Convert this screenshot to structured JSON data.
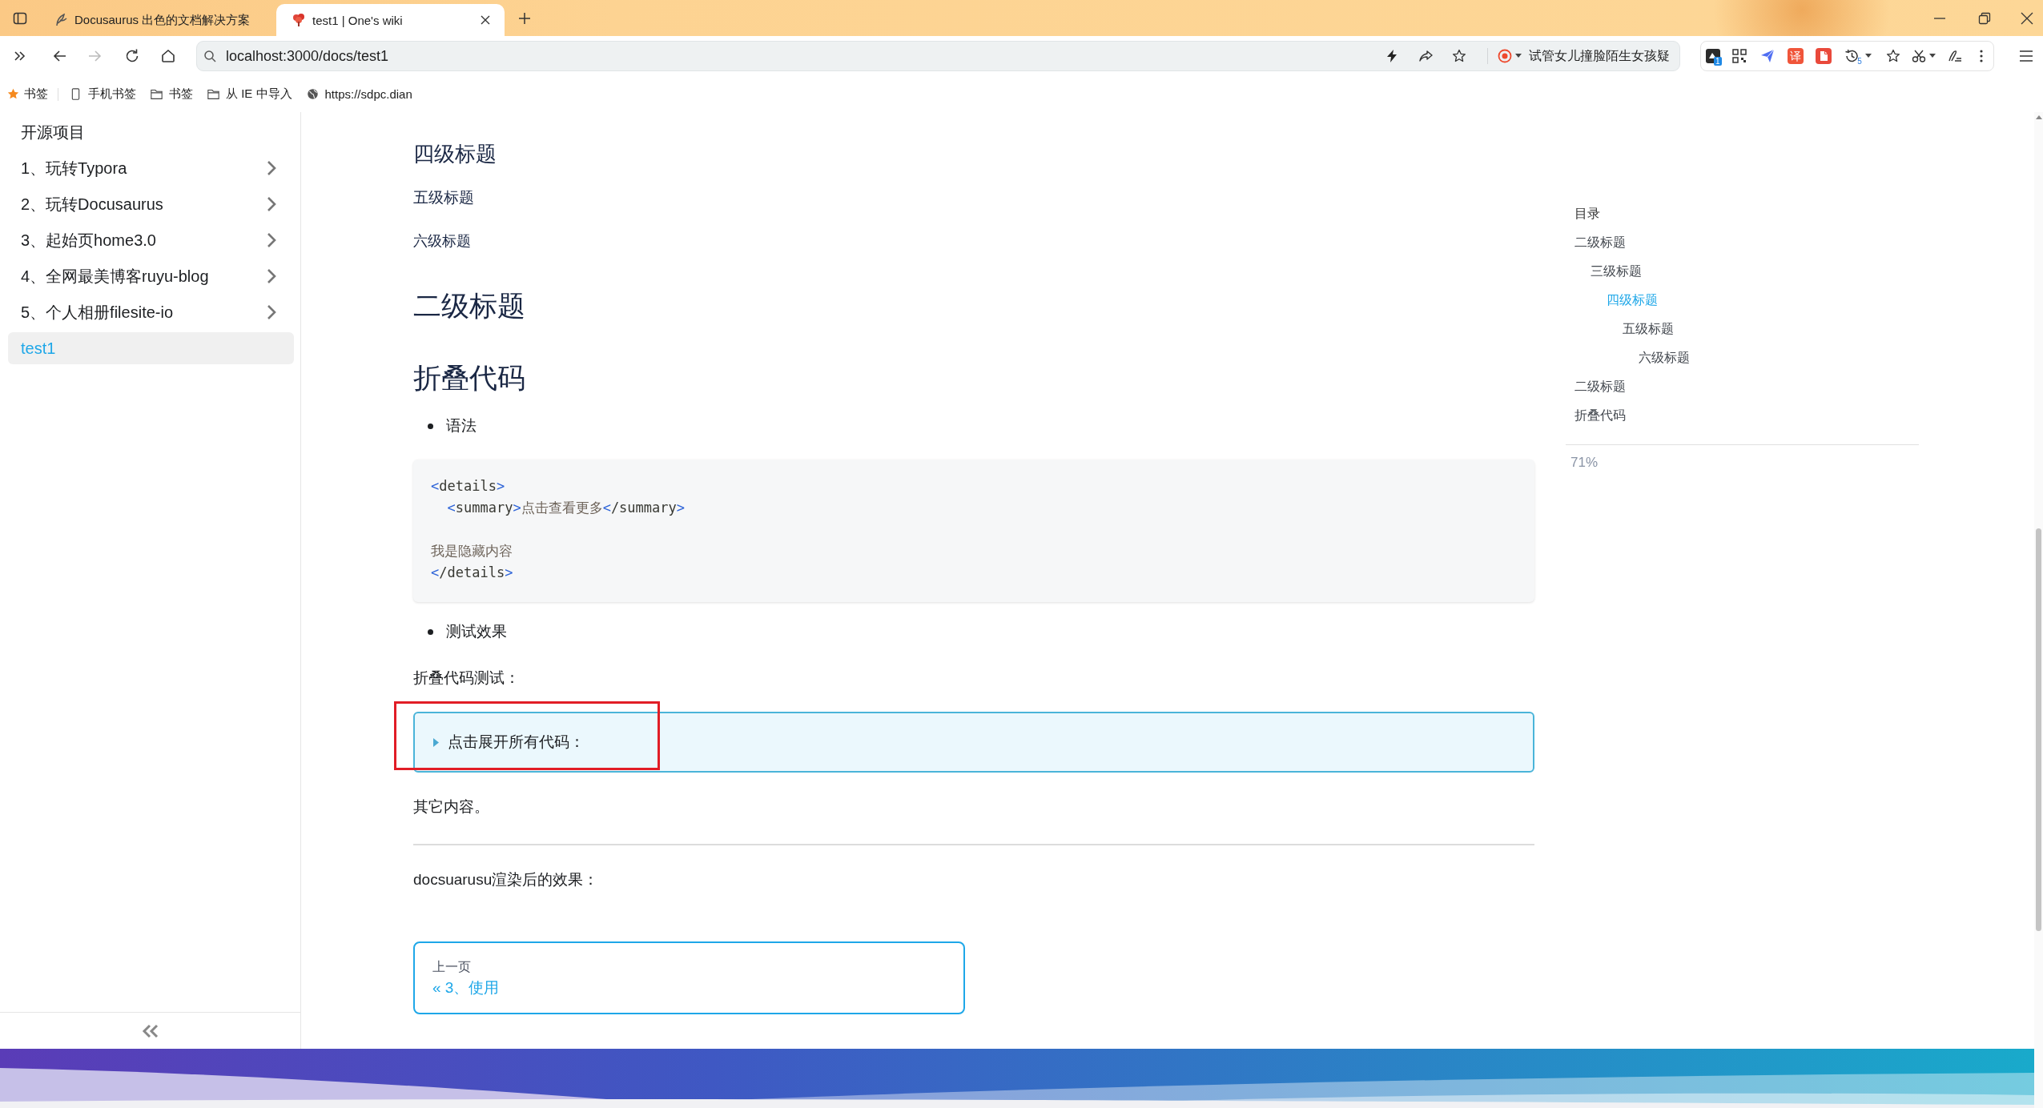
{
  "browser": {
    "tabs": [
      {
        "kind": "docs",
        "title": "Docusaurus 出色的文档解决方案",
        "selected": false
      },
      {
        "kind": "wiki",
        "title": "test1 | One's wiki",
        "selected": true
      }
    ],
    "navigation": {
      "back": {
        "disabled": false
      },
      "forward": {
        "disabled": true
      }
    },
    "address": "localhost:3000/docs/test1",
    "search_box": {
      "value": "试管女儿撞脸陌生女孩疑"
    },
    "extensions": [
      {
        "kind": "app",
        "badge": "1"
      },
      {
        "kind": "qr"
      },
      {
        "kind": "send"
      },
      {
        "kind": "translate",
        "label": "译"
      },
      {
        "kind": "pdf"
      },
      {
        "kind": "history",
        "badge": "5"
      },
      {
        "kind": "favorite"
      },
      {
        "kind": "scissors"
      },
      {
        "kind": "signature"
      },
      {
        "kind": "more"
      }
    ],
    "bookmarks": [
      {
        "kind": "star",
        "label": "书签"
      },
      {
        "kind": "phone",
        "label": "手机书签"
      },
      {
        "kind": "folder",
        "label": "书签"
      },
      {
        "kind": "folder",
        "label": "从 IE 中导入"
      },
      {
        "kind": "site",
        "label": "https://sdpc.dian"
      }
    ]
  },
  "sidebar": {
    "items": [
      {
        "kind": "link",
        "label": "开源项目",
        "selected": false
      },
      {
        "kind": "category",
        "label": "1、玩转Typora",
        "expanded": false,
        "selected": false
      },
      {
        "kind": "category",
        "label": "2、玩转Docusaurus",
        "expanded": false,
        "selected": false
      },
      {
        "kind": "category",
        "label": "3、起始页home3.0",
        "expanded": false,
        "selected": false
      },
      {
        "kind": "category",
        "label": "4、全网最美博客ruyu-blog",
        "expanded": false,
        "selected": false
      },
      {
        "kind": "category",
        "label": "5、个人相册filesite-io",
        "expanded": false,
        "selected": false
      },
      {
        "kind": "link",
        "label": "test1",
        "selected": true
      }
    ]
  },
  "article": {
    "blocks": [
      {
        "kind": "h4",
        "text": "四级标题"
      },
      {
        "kind": "h5",
        "text": "五级标题"
      },
      {
        "kind": "h6",
        "text": "六级标题"
      },
      {
        "kind": "h2",
        "text": "二级标题"
      },
      {
        "kind": "h2",
        "text": "折叠代码"
      },
      {
        "kind": "bullet",
        "text": "语法"
      },
      {
        "kind": "code",
        "lines": [
          {
            "kind": "code",
            "tokens": [
              {
                "kind": "punct",
                "text": "<"
              },
              {
                "kind": "tag",
                "text": "details"
              },
              {
                "kind": "punct",
                "text": ">"
              }
            ],
            "children": [
              {
                "kind": "code",
                "tokens": [
                  {
                    "kind": "punct",
                    "text": "<"
                  },
                  {
                    "kind": "tag",
                    "text": "summary"
                  },
                  {
                    "kind": "punct",
                    "text": ">"
                  },
                  {
                    "kind": "text",
                    "text": "点击查看更多"
                  },
                  {
                    "kind": "punct",
                    "text": "<"
                  },
                  {
                    "kind": "tag",
                    "text": "/summary"
                  },
                  {
                    "kind": "punct",
                    "text": ">"
                  }
                ]
              }
            ]
          },
          {
            "kind": "blank"
          },
          {
            "kind": "code",
            "tokens": [
              {
                "kind": "text",
                "text": "我是隐藏内容"
              }
            ]
          },
          {
            "kind": "code",
            "tokens": [
              {
                "kind": "punct",
                "text": "<"
              },
              {
                "kind": "tag",
                "text": "/details"
              },
              {
                "kind": "punct",
                "text": ">"
              }
            ]
          }
        ]
      },
      {
        "kind": "bullet",
        "text": "测试效果"
      },
      {
        "kind": "paragraph",
        "text": "折叠代码测试："
      },
      {
        "kind": "details",
        "summary": "点击展开所有代码：",
        "expanded": false,
        "highlighted": true
      },
      {
        "kind": "paragraph",
        "text": "其它内容。"
      },
      {
        "kind": "rule"
      },
      {
        "kind": "paragraph",
        "text": "docsuarusu渲染后的效果："
      }
    ]
  },
  "pagination": {
    "previous": {
      "label": "上一页",
      "title": "« 3、使用"
    }
  },
  "toc": {
    "title": "目录",
    "items": [
      {
        "label": "二级标题",
        "selected": false,
        "children": [
          {
            "label": "三级标题",
            "selected": false,
            "children": [
              {
                "label": "四级标题",
                "selected": true,
                "children": [
                  {
                    "label": "五级标题",
                    "selected": false,
                    "children": [
                      {
                        "label": "六级标题",
                        "selected": false
                      }
                    ]
                  }
                ]
              }
            ]
          }
        ]
      },
      {
        "label": "二级标题",
        "selected": false
      },
      {
        "label": "折叠代码",
        "selected": false
      }
    ],
    "progress": "71%"
  }
}
